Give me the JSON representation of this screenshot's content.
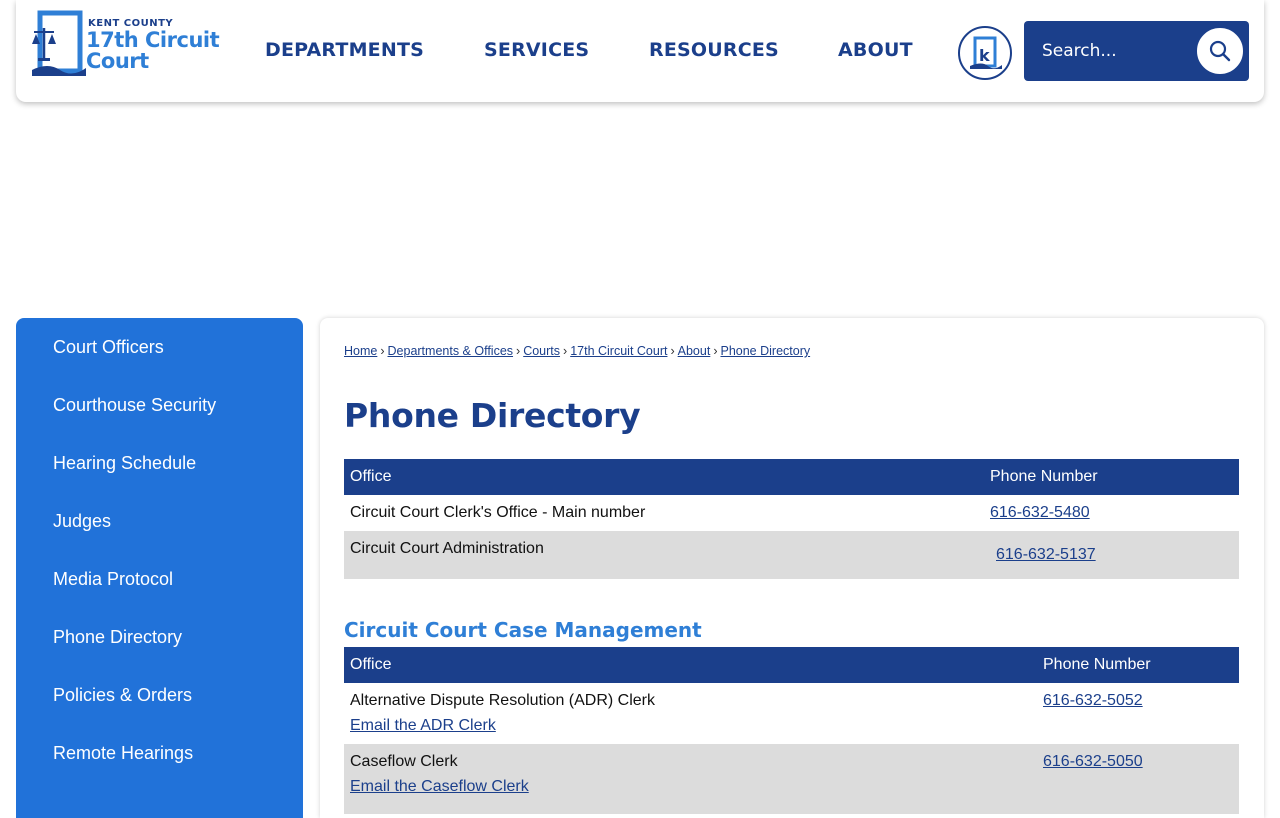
{
  "header": {
    "logo": {
      "county": "KENT COUNTY",
      "line1": "17th Circuit",
      "line2": "Court"
    },
    "nav": [
      "DEPARTMENTS",
      "SERVICES",
      "RESOURCES",
      "ABOUT"
    ],
    "search_placeholder": "Search..."
  },
  "sidebar": {
    "items": [
      "Court Officers",
      "Courthouse Security",
      "Hearing Schedule",
      "Judges",
      "Media Protocol",
      "Phone Directory",
      "Policies & Orders",
      "Remote Hearings"
    ]
  },
  "breadcrumb": [
    "Home",
    "Departments & Offices",
    "Courts",
    "17th Circuit Court",
    "About",
    "Phone Directory"
  ],
  "page_title": "Phone Directory",
  "table1": {
    "headers": [
      "Office",
      "Phone Number"
    ],
    "rows": [
      {
        "office": "Circuit Court Clerk's Office - Main number",
        "phone": "616-632-5480"
      },
      {
        "office": "Circuit Court Administration",
        "phone": "616-632-5137"
      }
    ]
  },
  "section2_title": "Circuit Court Case Management",
  "table2": {
    "headers": [
      "Office",
      "Phone Number"
    ],
    "rows": [
      {
        "office": "Alternative Dispute Resolution (ADR) Clerk",
        "email": "Email the ADR Clerk",
        "phone": "616-632-5052"
      },
      {
        "office": "Caseflow Clerk",
        "email": "Email the Caseflow Clerk",
        "phone": "616-632-5050"
      }
    ]
  },
  "colors": {
    "navy": "#1b3f8b",
    "blue": "#2172d9",
    "light_blue": "#2f7fd6",
    "row_alt": "#dcdcdc"
  }
}
